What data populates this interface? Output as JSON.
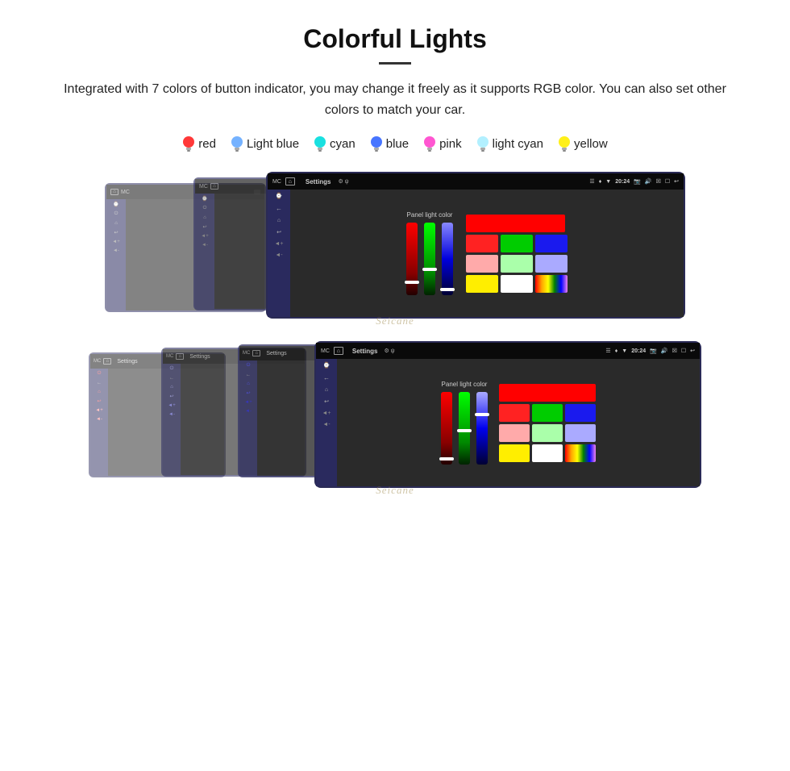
{
  "page": {
    "title": "Colorful Lights",
    "description": "Integrated with 7 colors of button indicator, you may change it freely as it supports RGB color. You can also set other colors to match your car.",
    "divider": "—"
  },
  "colors": [
    {
      "name": "red",
      "color": "#ff2222",
      "label": "red"
    },
    {
      "name": "light-blue",
      "color": "#66aaff",
      "label": "Light blue"
    },
    {
      "name": "cyan",
      "color": "#00dddd",
      "label": "cyan"
    },
    {
      "name": "blue",
      "color": "#3366ff",
      "label": "blue"
    },
    {
      "name": "pink",
      "color": "#ff44cc",
      "label": "pink"
    },
    {
      "name": "light-cyan",
      "color": "#aaeeff",
      "label": "light cyan"
    },
    {
      "name": "yellow",
      "color": "#ffee00",
      "label": "yellow"
    }
  ],
  "panel_label": "Panel light color",
  "color_grid_top": [
    "#ff0000",
    "#00cc00",
    "#0000cc",
    "#ff0000",
    "#00cc00",
    "#0000cc",
    "#ff9999",
    "#99cc99",
    "#9999cc",
    "#ffee00",
    "#ffffff",
    "rainbow"
  ],
  "watermark": "Seicane",
  "header": {
    "title": "Settings",
    "time": "20:24"
  }
}
